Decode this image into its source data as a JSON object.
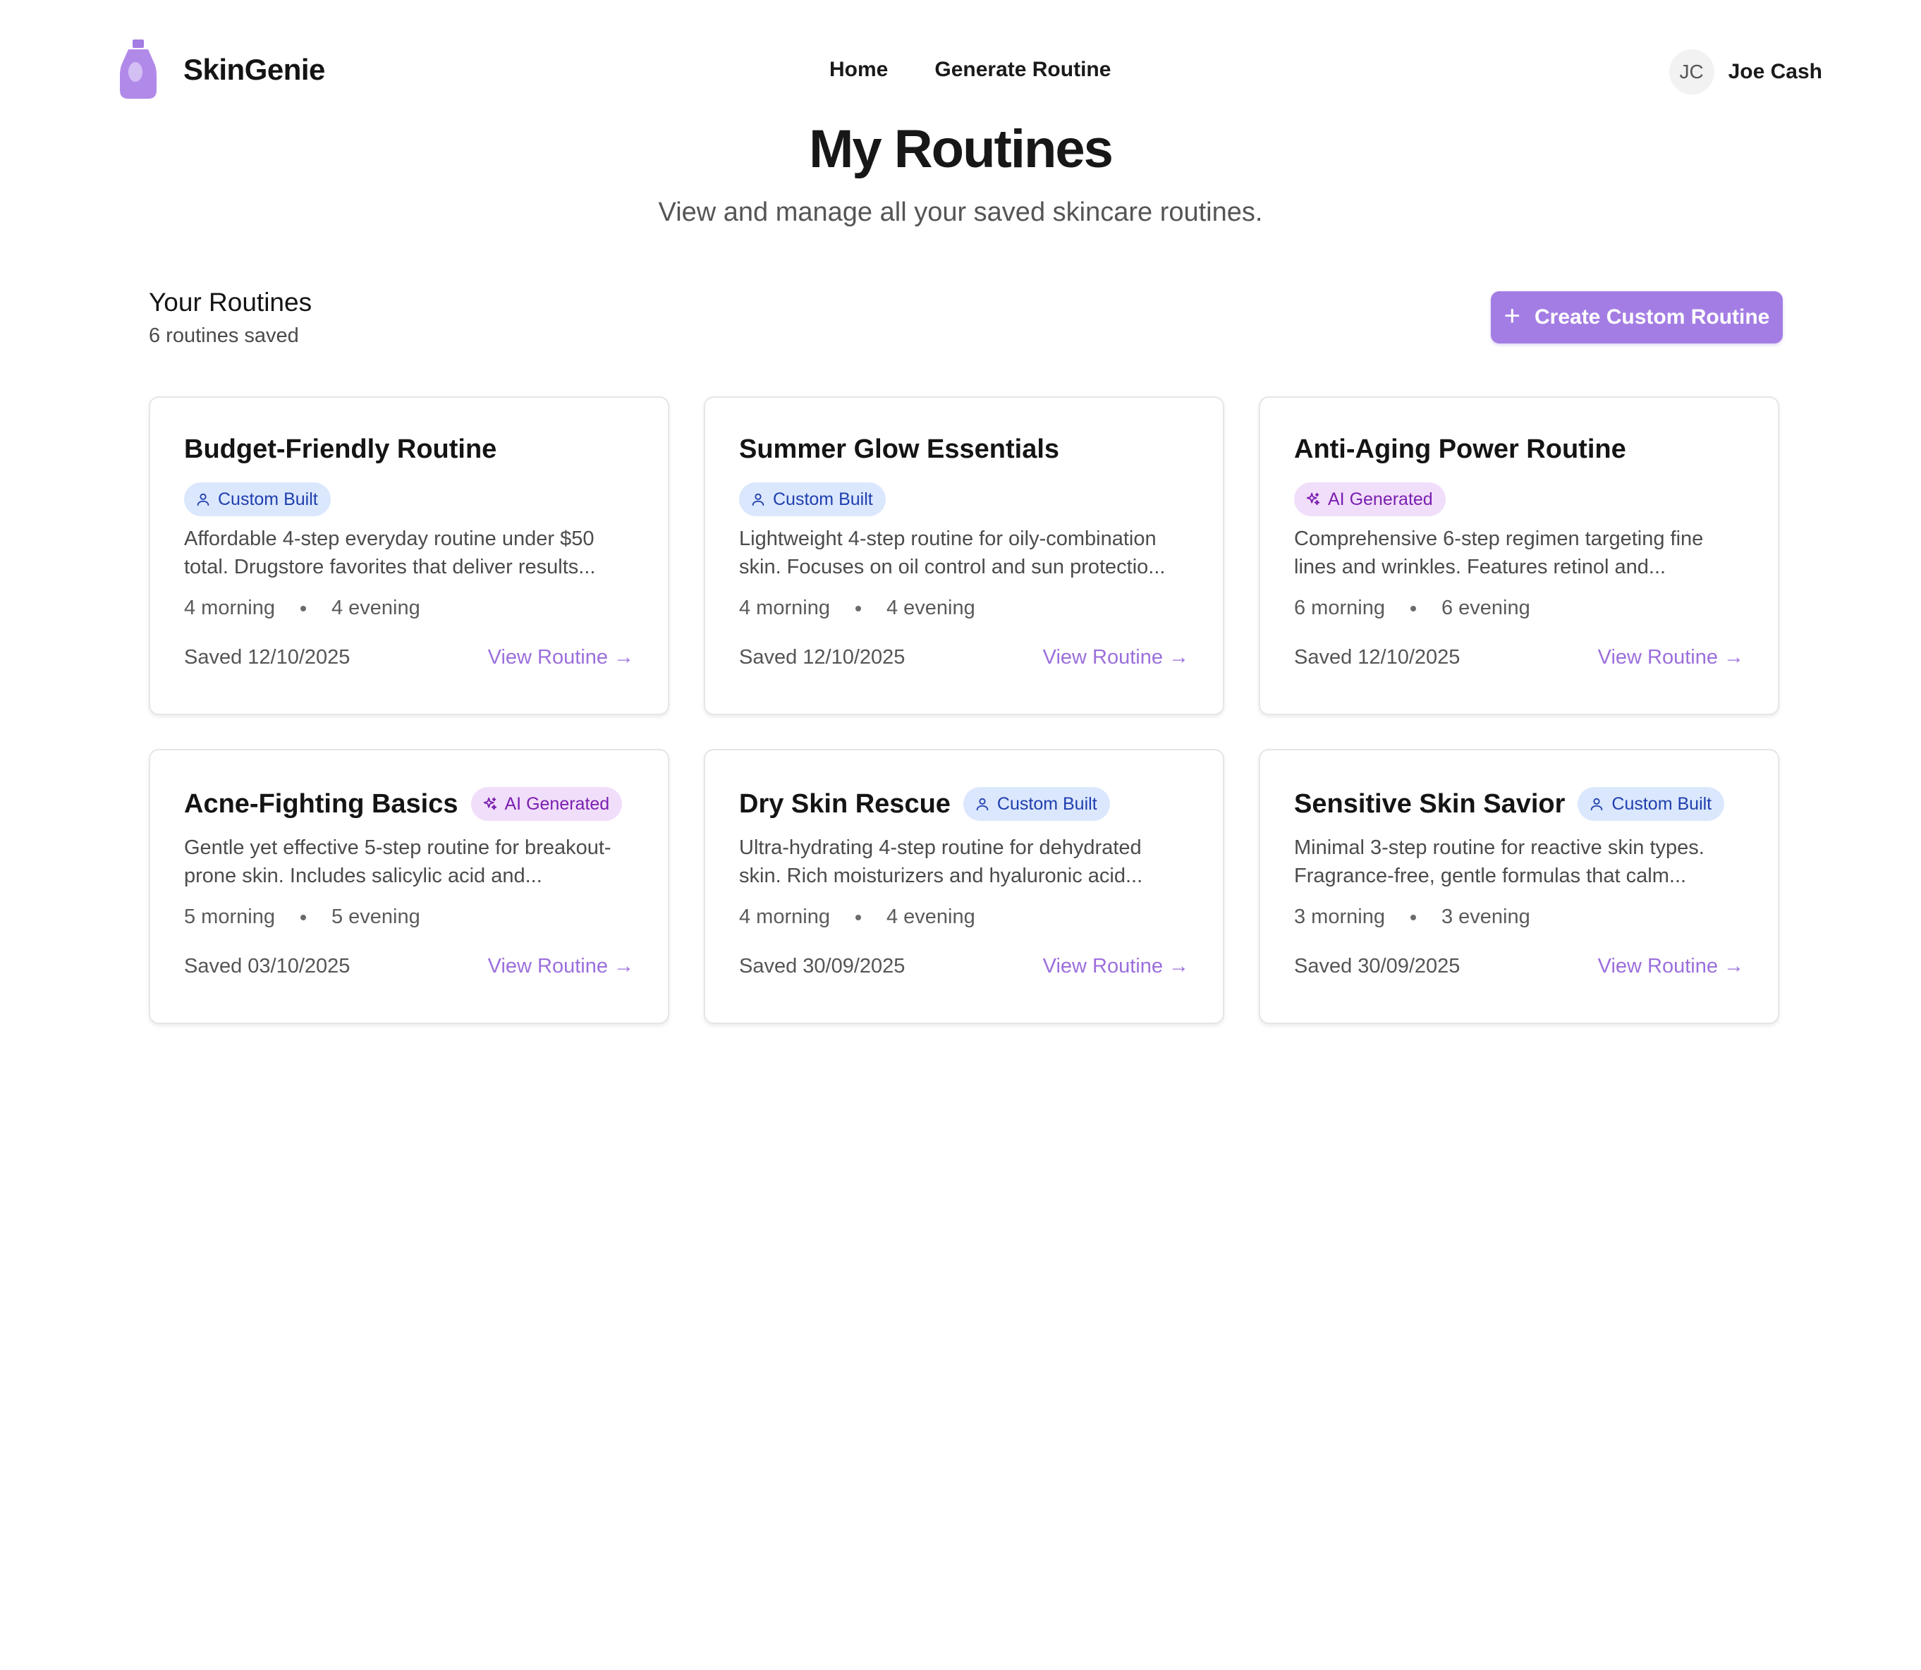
{
  "app": {
    "name": "SkinGenie"
  },
  "nav": {
    "home": "Home",
    "generate": "Generate Routine"
  },
  "user": {
    "initials": "JC",
    "name": "Joe Cash"
  },
  "page": {
    "title": "My Routines",
    "subtitle": "View and manage all your saved skincare routines."
  },
  "section": {
    "title": "Your Routines",
    "count": "6 routines saved",
    "create_label": "Create Custom Routine"
  },
  "colors": {
    "accent": "#a47de4",
    "link": "#9b6fdc",
    "custom_badge_bg": "#dbe7fd",
    "custom_badge_text": "#1f3fae",
    "ai_badge_bg": "#f1defa",
    "ai_badge_text": "#7a1fb0"
  },
  "cards": [
    {
      "title": "Budget-Friendly Routine",
      "badge": "Custom Built",
      "badge_icon": "user-icon",
      "desc_1": "Affordable 4-step everyday routine under $50",
      "desc_2": "total. Drugstore favorites that deliver results...",
      "morning": "4 morning",
      "evening": "4 evening",
      "saved": "Saved 12/10/2025",
      "link": "View Routine"
    },
    {
      "title": "Summer Glow Essentials",
      "badge": "Custom Built",
      "badge_icon": "user-icon",
      "desc_1": "Lightweight 4-step routine for oily-combination",
      "desc_2": "skin. Focuses on oil control and sun protectio...",
      "morning": "4 morning",
      "evening": "4 evening",
      "saved": "Saved 12/10/2025",
      "link": "View Routine"
    },
    {
      "title": "Anti-Aging Power Routine",
      "badge": "AI Generated",
      "badge_icon": "sparkle-icon",
      "desc_1": "Comprehensive 6-step regimen targeting fine",
      "desc_2": "lines and wrinkles. Features retinol and...",
      "morning": "6 morning",
      "evening": "6 evening",
      "saved": "Saved 12/10/2025",
      "link": "View Routine"
    },
    {
      "title": "Acne-Fighting Basics",
      "badge": "AI Generated",
      "badge_icon": "sparkle-icon",
      "desc_1": "Gentle yet effective 5-step routine for breakout-",
      "desc_2": "prone skin. Includes salicylic acid and...",
      "morning": "5 morning",
      "evening": "5 evening",
      "saved": "Saved 03/10/2025",
      "link": "View Routine"
    },
    {
      "title": "Dry Skin Rescue",
      "badge": "Custom Built",
      "badge_icon": "user-icon",
      "desc_1": "Ultra-hydrating 4-step routine for dehydrated",
      "desc_2": "skin. Rich moisturizers and hyaluronic acid...",
      "morning": "4 morning",
      "evening": "4 evening",
      "saved": "Saved 30/09/2025",
      "link": "View Routine"
    },
    {
      "title": "Sensitive Skin Savior",
      "badge": "Custom Built",
      "badge_icon": "user-icon",
      "desc_1": "Minimal 3-step routine for reactive skin types.",
      "desc_2": "Fragrance-free, gentle formulas that calm...",
      "morning": "3 morning",
      "evening": "3 evening",
      "saved": "Saved 30/09/2025",
      "link": "View Routine"
    }
  ]
}
